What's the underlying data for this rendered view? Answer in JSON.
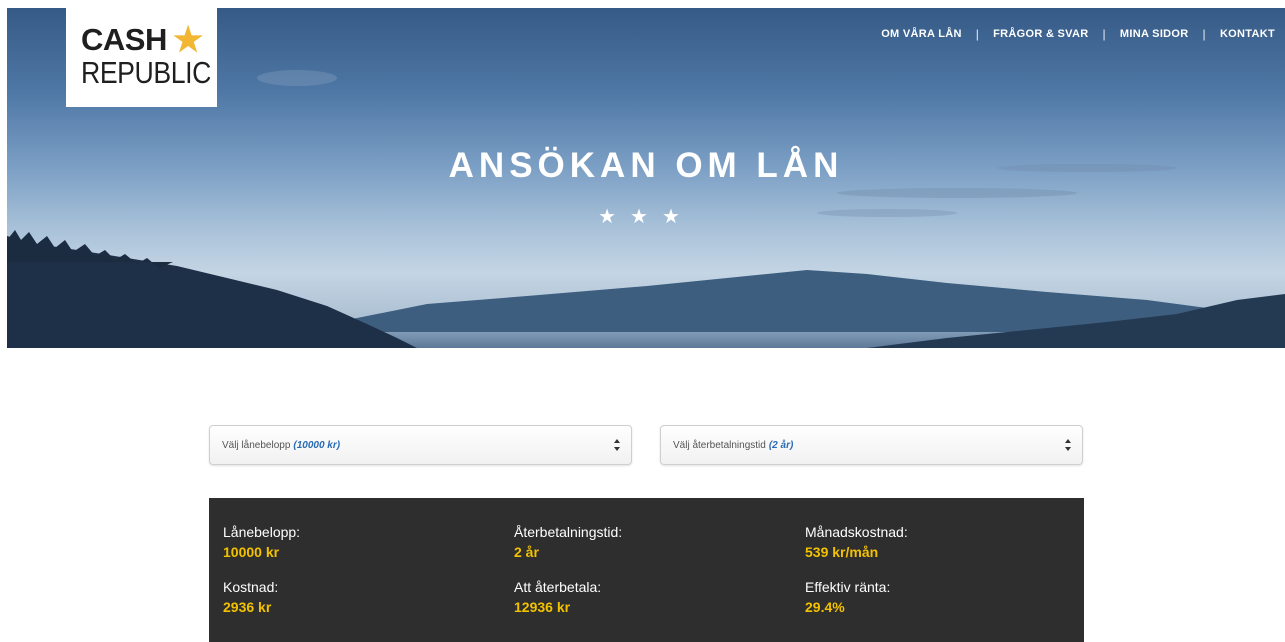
{
  "brand": {
    "line1": "CASH",
    "line2": "REPUBLIC",
    "star_color": "#f2b632"
  },
  "nav": {
    "items": [
      "OM VÅRA LÅN",
      "FRÅGOR & SVAR",
      "MINA SIDOR",
      "KONTAKT"
    ],
    "separator": "|"
  },
  "hero": {
    "title": "ANSÖKAN OM LÅN",
    "stars": "★★★"
  },
  "selects": {
    "amount": {
      "label": "Välj lånebelopp",
      "value": "(10000 kr)"
    },
    "term": {
      "label": "Välj återbetalningstid",
      "value": "(2 år)"
    }
  },
  "summary": {
    "loan_amount": {
      "label": "Lånebelopp:",
      "value": "10000 kr"
    },
    "term": {
      "label": "Återbetalningstid:",
      "value": "2 år"
    },
    "monthly": {
      "label": "Månadskostnad:",
      "value": "539 kr/mån"
    },
    "cost": {
      "label": "Kostnad:",
      "value": "2936 kr"
    },
    "total": {
      "label": "Att återbetala:",
      "value": "12936 kr"
    },
    "rate": {
      "label": "Effektiv ränta:",
      "value": "29.4%"
    }
  },
  "colors": {
    "accent_yellow": "#f2c200",
    "link_blue": "#2a6bb5",
    "panel_bg": "#2e2e2e"
  }
}
